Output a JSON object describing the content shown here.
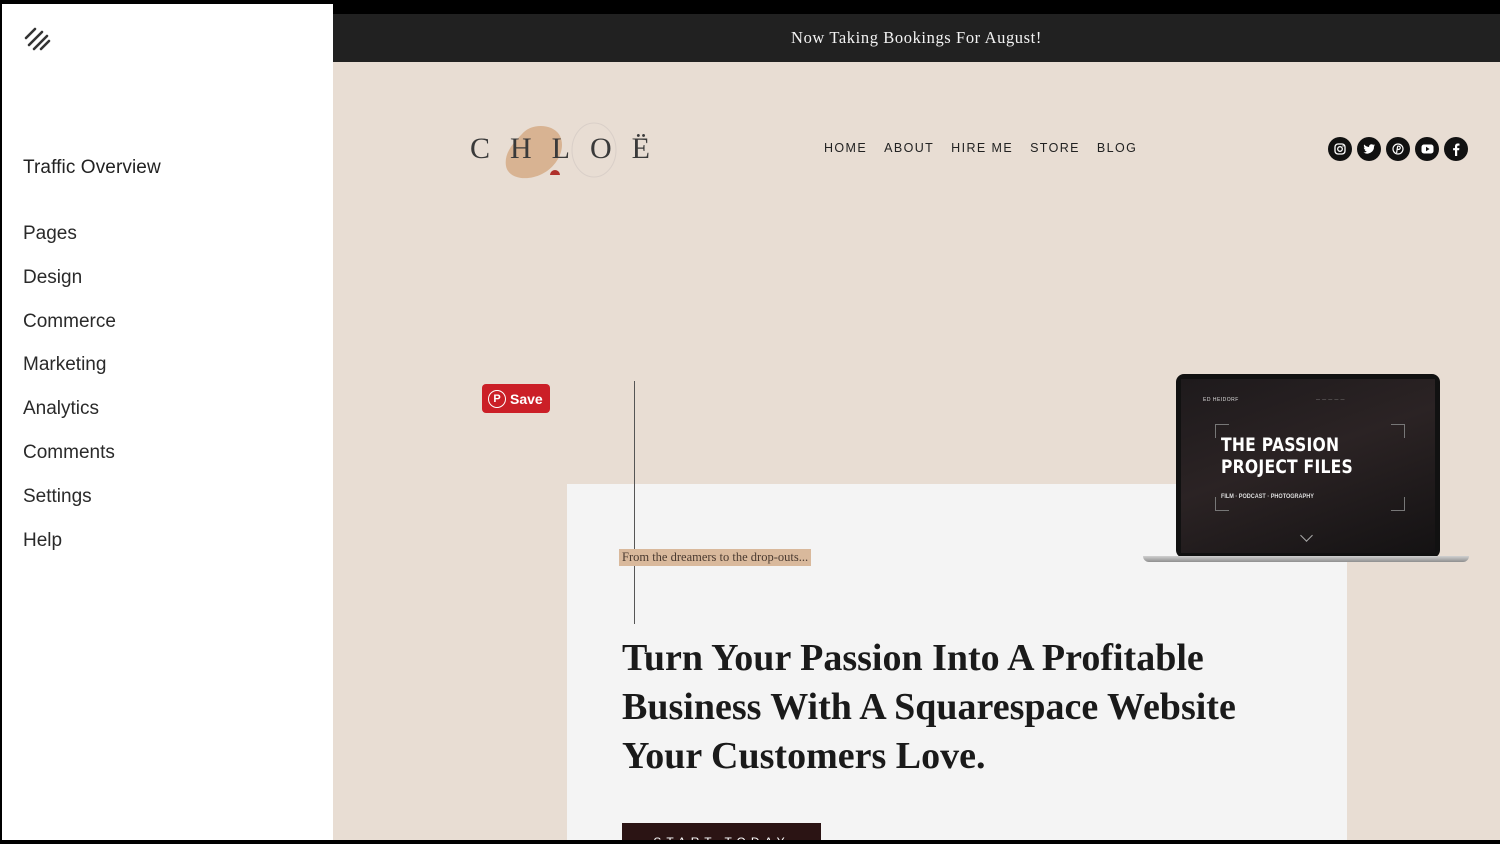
{
  "sidebar": {
    "title": "Traffic Overview",
    "items": [
      "Pages",
      "Design",
      "Commerce",
      "Marketing",
      "Analytics",
      "Comments",
      "Settings",
      "Help"
    ]
  },
  "site": {
    "announcement": "Now Taking Bookings For August!",
    "logo_text": "CHLOË",
    "nav": [
      "HOME",
      "ABOUT",
      "HIRE ME",
      "STORE",
      "BLOG"
    ],
    "social_icons": [
      "instagram-icon",
      "twitter-icon",
      "pinterest-icon",
      "youtube-icon",
      "facebook-icon"
    ],
    "pin_save_label": "Save",
    "tagline": "From the dreamers to the drop-outs...",
    "hero_heading": "Turn Your Passion Into A Profitable Business With A Squarespace Website Your Customers Love.",
    "cta_label": "START TODAY",
    "laptop": {
      "brand": "ED HEIDORF",
      "title_line1": "THE PASSION",
      "title_line2": "PROJECT FILES",
      "subtitle": "FILM · PODCAST · PHOTOGRAPHY"
    }
  },
  "colors": {
    "announcement_bg": "#212121",
    "page_bg": "#e8ddd3",
    "pinterest_red": "#cb1f27",
    "tagline_highlight": "#d9b99c",
    "cta_bg": "#2b1414"
  }
}
